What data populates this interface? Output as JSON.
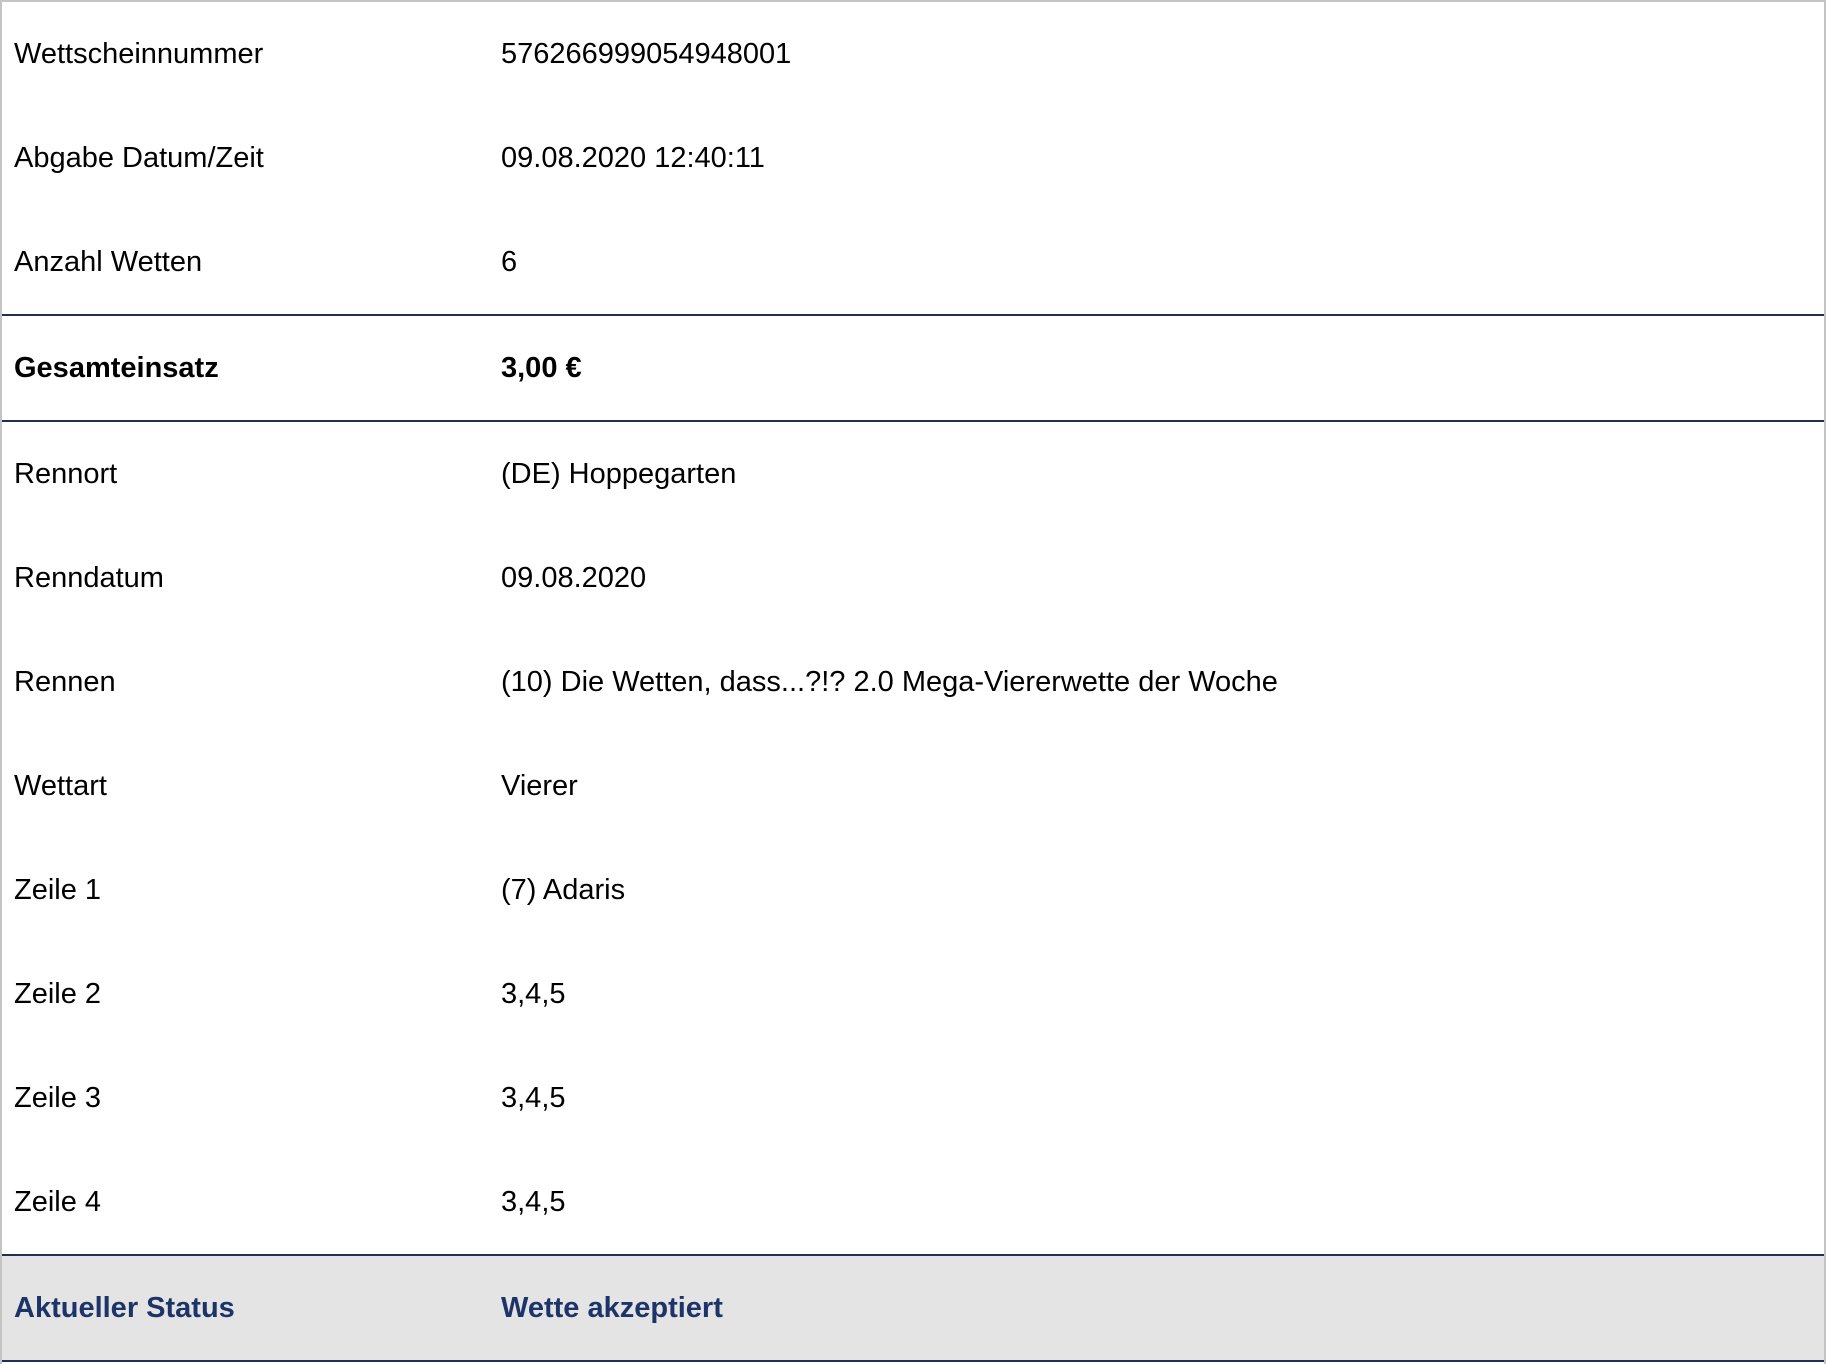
{
  "colors": {
    "divider": "#1e2f5a",
    "status_text": "#1c3468",
    "status_background": "#e4e4e4"
  },
  "ticket": {
    "rows_top": [
      {
        "label": "Wettscheinnummer",
        "value": "576266999054948001"
      },
      {
        "label": "Abgabe Datum/Zeit",
        "value": "09.08.2020 12:40:11"
      },
      {
        "label": "Anzahl Wetten",
        "value": "6"
      }
    ],
    "total": {
      "label": "Gesamteinsatz",
      "value": "3,00 €"
    },
    "rows_details": [
      {
        "label": "Rennort",
        "value": "(DE) Hoppegarten"
      },
      {
        "label": "Renndatum",
        "value": "09.08.2020"
      },
      {
        "label": "Rennen",
        "value": "(10) Die Wetten, dass...?!? 2.0 Mega-Viererwette der Woche"
      },
      {
        "label": "Wettart",
        "value": "Vierer"
      },
      {
        "label": "Zeile 1",
        "value": "(7) Adaris"
      },
      {
        "label": "Zeile 2",
        "value": "3,4,5"
      },
      {
        "label": "Zeile 3",
        "value": "3,4,5"
      },
      {
        "label": "Zeile 4",
        "value": "3,4,5"
      }
    ],
    "status": {
      "label": "Aktueller Status",
      "value": "Wette akzeptiert"
    }
  }
}
